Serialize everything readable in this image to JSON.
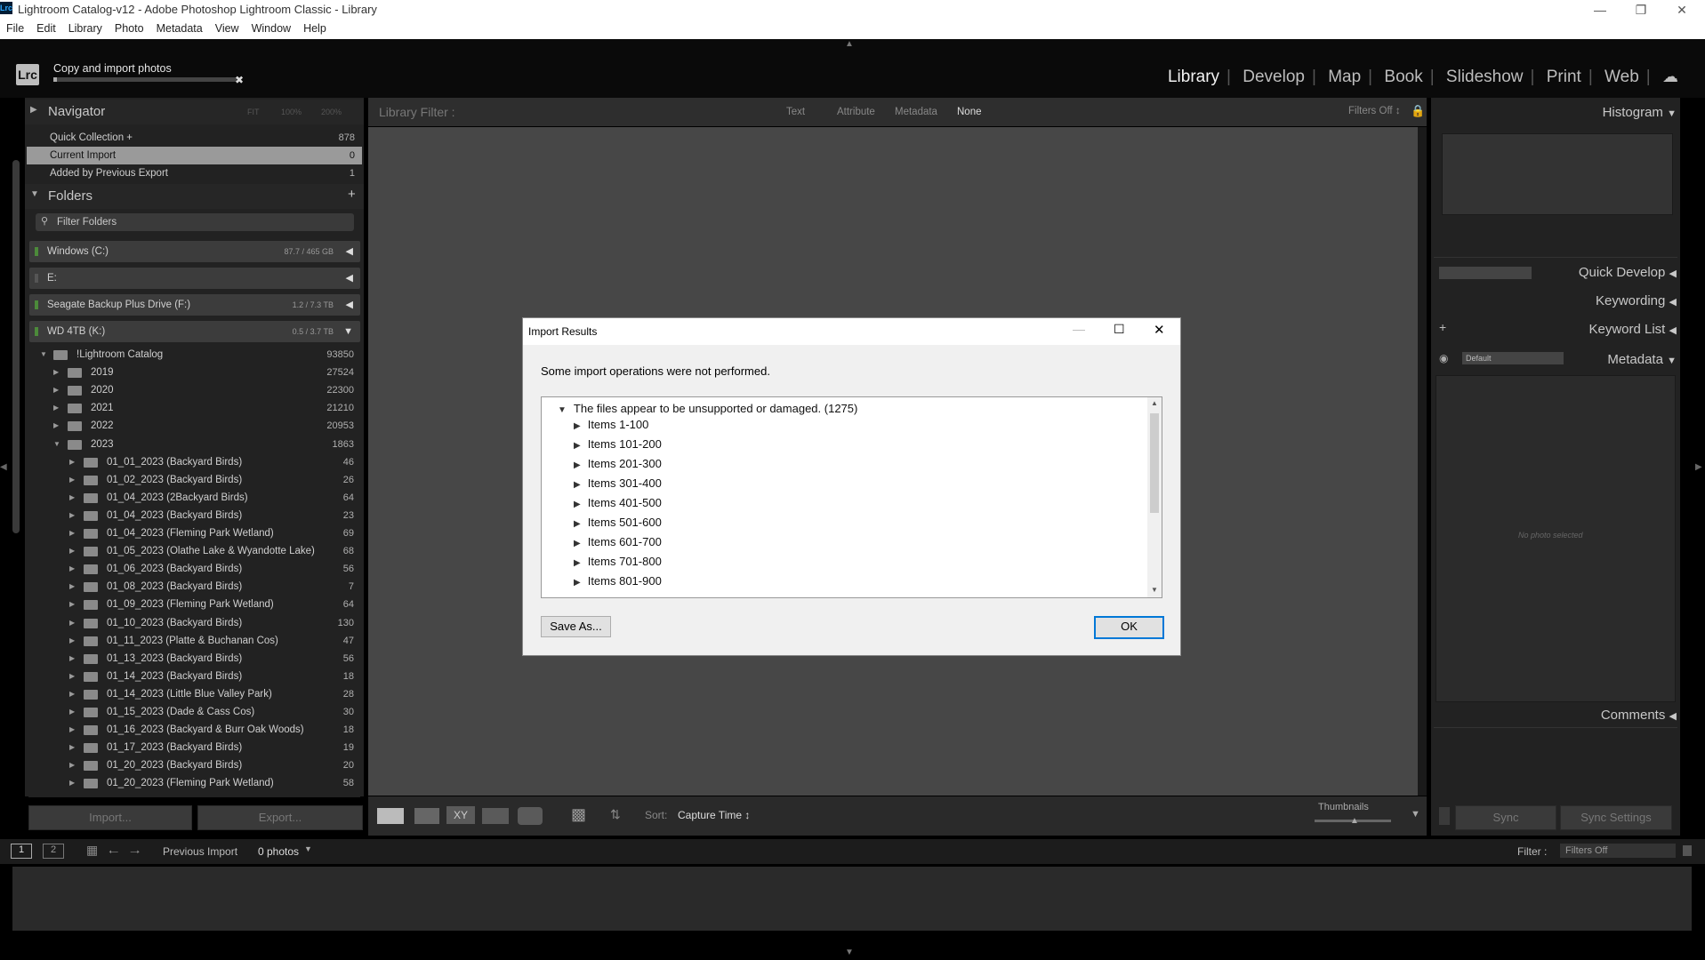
{
  "window": {
    "title": "Lightroom Catalog-v12 - Adobe Photoshop Lightroom Classic - Library",
    "app_icon": "Lrc",
    "controls": [
      "minimize-icon",
      "restore-icon",
      "close-icon"
    ]
  },
  "menubar": [
    "File",
    "Edit",
    "Library",
    "Photo",
    "Metadata",
    "View",
    "Window",
    "Help"
  ],
  "header": {
    "logo": "Lrc",
    "task_name": "Copy and import photos",
    "modules": [
      "Library",
      "Develop",
      "Map",
      "Book",
      "Slideshow",
      "Print",
      "Web"
    ],
    "active_module": "Library"
  },
  "left": {
    "navigator": {
      "label": "Navigator",
      "zoom": [
        "FIT",
        "100%",
        "200%"
      ]
    },
    "catalog": [
      {
        "label": "Quick Collection +",
        "count": "878"
      },
      {
        "label": "Current Import",
        "count": "0"
      },
      {
        "label": "Added by Previous Export",
        "count": "1"
      }
    ],
    "folders": {
      "label": "Folders",
      "add": "+",
      "filter_placeholder": "Filter Folders",
      "volumes": [
        {
          "name": "Windows (C:)",
          "cap": "87.7 / 465 GB"
        },
        {
          "name": "E:",
          "cap": ""
        },
        {
          "name": "Seagate Backup Plus Drive (F:)",
          "cap": "1.2 / 7.3 TB"
        },
        {
          "name": "WD 4TB (K:)",
          "cap": "0.5 / 3.7 TB"
        }
      ],
      "tree": [
        {
          "label": "!Lightroom Catalog",
          "count": "93850",
          "level": 0,
          "open": true
        },
        {
          "label": "2019",
          "count": "27524",
          "level": 1,
          "open": false
        },
        {
          "label": "2020",
          "count": "22300",
          "level": 1,
          "open": false
        },
        {
          "label": "2021",
          "count": "21210",
          "level": 1,
          "open": false
        },
        {
          "label": "2022",
          "count": "20953",
          "level": 1,
          "open": false
        },
        {
          "label": "2023",
          "count": "1863",
          "level": 1,
          "open": true
        },
        {
          "label": "01_01_2023 (Backyard Birds)",
          "count": "46",
          "level": 2,
          "open": false
        },
        {
          "label": "01_02_2023 (Backyard Birds)",
          "count": "26",
          "level": 2,
          "open": false
        },
        {
          "label": "01_04_2023 (2Backyard Birds)",
          "count": "64",
          "level": 2,
          "open": false
        },
        {
          "label": "01_04_2023 (Backyard Birds)",
          "count": "23",
          "level": 2,
          "open": false
        },
        {
          "label": "01_04_2023 (Fleming Park Wetland)",
          "count": "69",
          "level": 2,
          "open": false
        },
        {
          "label": "01_05_2023 (Olathe Lake & Wyandotte Lake)",
          "count": "68",
          "level": 2,
          "open": false
        },
        {
          "label": "01_06_2023 (Backyard Birds)",
          "count": "56",
          "level": 2,
          "open": false
        },
        {
          "label": "01_08_2023 (Backyard Birds)",
          "count": "7",
          "level": 2,
          "open": false
        },
        {
          "label": "01_09_2023 (Fleming Park Wetland)",
          "count": "64",
          "level": 2,
          "open": false
        },
        {
          "label": "01_10_2023 (Backyard Birds)",
          "count": "130",
          "level": 2,
          "open": false
        },
        {
          "label": "01_11_2023 (Platte & Buchanan Cos)",
          "count": "47",
          "level": 2,
          "open": false
        },
        {
          "label": "01_13_2023 (Backyard Birds)",
          "count": "56",
          "level": 2,
          "open": false
        },
        {
          "label": "01_14_2023 (Backyard Birds)",
          "count": "18",
          "level": 2,
          "open": false
        },
        {
          "label": "01_14_2023 (Little Blue Valley Park)",
          "count": "28",
          "level": 2,
          "open": false
        },
        {
          "label": "01_15_2023 (Dade & Cass Cos)",
          "count": "30",
          "level": 2,
          "open": false
        },
        {
          "label": "01_16_2023 (Backyard & Burr Oak Woods)",
          "count": "18",
          "level": 2,
          "open": false
        },
        {
          "label": "01_17_2023 (Backyard Birds)",
          "count": "19",
          "level": 2,
          "open": false
        },
        {
          "label": "01_20_2023 (Backyard Birds)",
          "count": "20",
          "level": 2,
          "open": false
        },
        {
          "label": "01_20_2023 (Fleming Park Wetland)",
          "count": "58",
          "level": 2,
          "open": false
        }
      ]
    },
    "import_button": "Import...",
    "export_button": "Export..."
  },
  "filter": {
    "label": "Library Filter :",
    "options": [
      "Text",
      "Attribute",
      "Metadata",
      "None"
    ],
    "active": "None",
    "preset": "Filters Off ↕"
  },
  "toolbar": {
    "sort_label": "Sort:",
    "sort_value": "Capture Time ↕",
    "thumbnails_label": "Thumbnails"
  },
  "right": {
    "histogram": "Histogram",
    "quick_develop": "Quick Develop",
    "keywording": "Keywording",
    "keyword_list": "Keyword List",
    "metadata": "Metadata",
    "metadata_preset": "Default",
    "no_photo": "No photo selected",
    "comments": "Comments",
    "sync": "Sync",
    "sync_settings": "Sync Settings"
  },
  "filmstrip": {
    "page1": "1",
    "page2": "2",
    "source": "Previous Import",
    "count": "0 photos",
    "filter_label": "Filter :",
    "filter_value": "Filters Off"
  },
  "dialog": {
    "title": "Import Results",
    "message": "Some import operations were not performed.",
    "group": "The files appear to be unsupported or damaged. (1275)",
    "items": [
      "Items 1-100",
      "Items 101-200",
      "Items 201-300",
      "Items 301-400",
      "Items 401-500",
      "Items 501-600",
      "Items 601-700",
      "Items 701-800",
      "Items 801-900"
    ],
    "save_as": "Save As...",
    "ok": "OK"
  }
}
